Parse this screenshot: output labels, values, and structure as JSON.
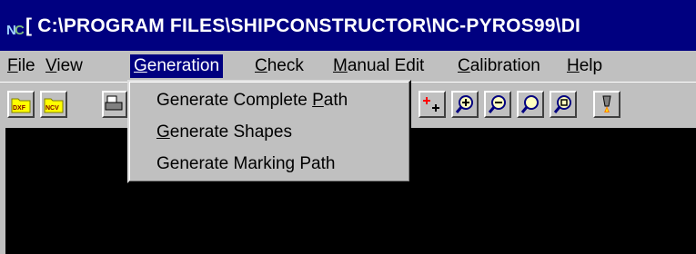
{
  "window": {
    "title": "[ C:\\PROGRAM FILES\\SHIPCONSTRUCTOR\\NC-PYROS99\\DI",
    "title_bar_color": "#000080",
    "icon": "nc-app-icon"
  },
  "menubar": {
    "items": [
      {
        "label_pre": "",
        "accel": "F",
        "label_post": "ile"
      },
      {
        "label_pre": "",
        "accel": "V",
        "label_post": "iew"
      },
      {
        "label_pre": "",
        "accel": "G",
        "label_post": "eneration"
      },
      {
        "label_pre": "",
        "accel": "C",
        "label_post": "heck"
      },
      {
        "label_pre": "",
        "accel": "M",
        "label_post": "anual Edit"
      },
      {
        "label_pre": "",
        "accel": "C",
        "label_post": "alibration"
      },
      {
        "label_pre": "",
        "accel": "H",
        "label_post": "elp"
      }
    ],
    "active_index": 2
  },
  "generation_menu": {
    "items": [
      {
        "label_pre": "Generate Complete ",
        "accel": "P",
        "label_post": "ath"
      },
      {
        "label_pre": "",
        "accel": "G",
        "label_post": "enerate Shapes"
      },
      {
        "label_pre": "Generate Marking Path",
        "accel": "",
        "label_post": ""
      }
    ]
  },
  "toolbar": {
    "buttons": [
      {
        "icon": "dxf-folder-icon",
        "text": "DXF"
      },
      {
        "icon": "ncv-folder-icon",
        "text": "NCV"
      },
      {
        "icon": "printer-icon",
        "text": ""
      },
      {
        "icon": "add-point-icon",
        "text": ""
      },
      {
        "icon": "zoom-in-icon",
        "text": ""
      },
      {
        "icon": "zoom-out-icon",
        "text": ""
      },
      {
        "icon": "zoom-icon",
        "text": ""
      },
      {
        "icon": "zoom-window-icon",
        "text": ""
      },
      {
        "icon": "torch-icon",
        "text": ""
      }
    ]
  },
  "colors": {
    "canvas": "#000000",
    "face": "#c0c0c0",
    "highlight": "#000080"
  }
}
